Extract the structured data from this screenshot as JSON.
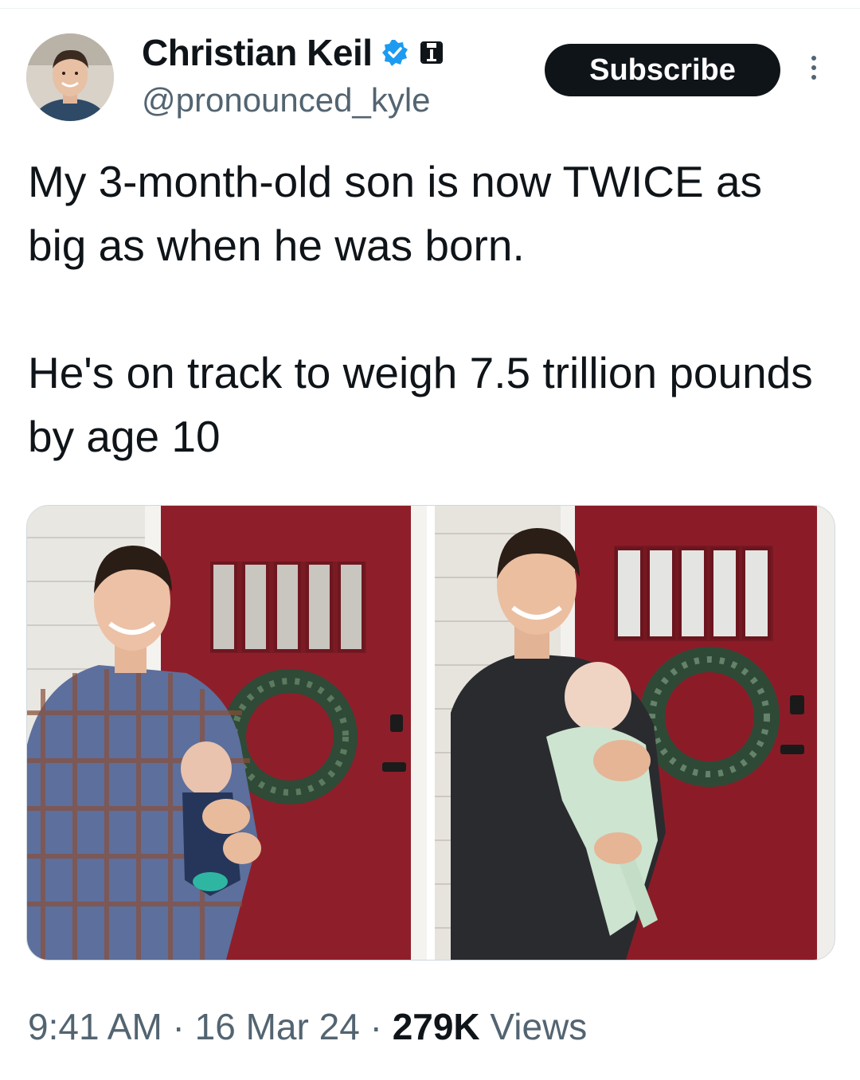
{
  "author": {
    "display_name": "Christian Keil",
    "handle": "@pronounced_kyle",
    "verified_icon": "verified-badge-icon",
    "affiliation_icon": "affiliate-badge-icon"
  },
  "actions": {
    "subscribe_label": "Subscribe",
    "more_icon": "more-vertical-icon"
  },
  "tweet": {
    "line1": "My 3-month-old son is now TWICE as big as when he was born.",
    "line2": "He's on track to weigh 7.5 trillion pounds by age 10"
  },
  "meta": {
    "time": "9:41 AM",
    "separator": " · ",
    "date": "16 Mar 24",
    "views_count": "279K",
    "views_label": " Views"
  },
  "colors": {
    "text": "#0f1419",
    "secondary": "#536471",
    "verified": "#1d9bf0",
    "door": "#8e1f2a"
  }
}
